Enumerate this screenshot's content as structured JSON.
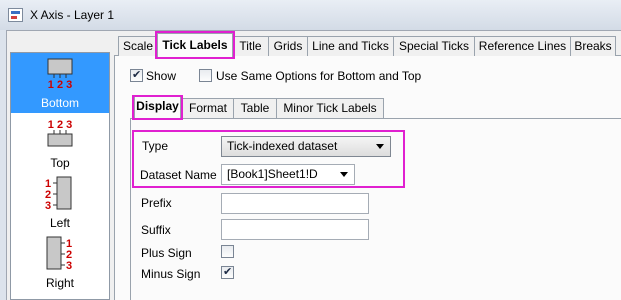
{
  "window": {
    "title": "X Axis - Layer 1"
  },
  "sidebar": {
    "items": [
      {
        "label": "Bottom",
        "selected": true,
        "ticks": "1 2 3"
      },
      {
        "label": "Top",
        "selected": false,
        "ticks": "1 2 3"
      },
      {
        "label": "Left",
        "selected": false,
        "ticks": "1 2 3"
      },
      {
        "label": "Right",
        "selected": false,
        "ticks": "1 2 3"
      }
    ]
  },
  "tabs": [
    {
      "label": "Scale"
    },
    {
      "label": "Tick Labels",
      "active": true
    },
    {
      "label": "Title"
    },
    {
      "label": "Grids"
    },
    {
      "label": "Line and Ticks"
    },
    {
      "label": "Special Ticks"
    },
    {
      "label": "Reference Lines"
    },
    {
      "label": "Breaks"
    }
  ],
  "options": {
    "show_label": "Show",
    "show_checked": true,
    "same_options_label": "Use Same Options for Bottom and Top",
    "same_options_checked": false
  },
  "inner_tabs": [
    {
      "label": "Display",
      "active": true
    },
    {
      "label": "Format"
    },
    {
      "label": "Table"
    },
    {
      "label": "Minor Tick Labels"
    }
  ],
  "form": {
    "type_label": "Type",
    "type_value": "Tick-indexed dataset",
    "dataset_name_label": "Dataset Name",
    "dataset_name_value": "[Book1]Sheet1!D",
    "prefix_label": "Prefix",
    "prefix_value": "",
    "suffix_label": "Suffix",
    "suffix_value": "",
    "plus_sign_label": "Plus Sign",
    "plus_sign_checked": false,
    "minus_sign_label": "Minus Sign",
    "minus_sign_checked": true
  },
  "colors": {
    "highlight": "#e020d0",
    "selection": "#3399ff",
    "tick_label_red": "#cc0000"
  }
}
